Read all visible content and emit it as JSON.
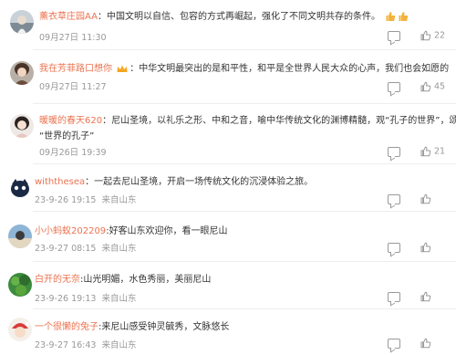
{
  "comments": [
    {
      "name": "薰衣草庄园AA",
      "text": "中国文明以自信、包容的方式再崛起，强化了不同文明共存的条件。",
      "emoji": "thumbs-up-icon",
      "time": "09月27日 11:30",
      "location": "",
      "likes": "22"
    },
    {
      "name": "我在芳菲路口想你",
      "text": "中华文明最突出的是和平性，和平是全世界人民大众的心声，我们也会如愿的",
      "time": "09月27日 11:27",
      "location": "",
      "likes": "45"
    },
    {
      "name": "暖暖的春天620",
      "text": "尼山圣境，以礼乐之形、中和之音，喻中华传统文化的渊博精髓，观“孔子的世界”，颂",
      "text2": "“世界的孔子”",
      "time": "09月26日 19:39",
      "location": "",
      "likes": "21"
    },
    {
      "name": "withthesea",
      "text": "一起去尼山圣境，开启一场传统文化的沉浸体验之旅。",
      "time": "23-9-26 19:15",
      "location": "来自山东",
      "likes": ""
    },
    {
      "name": "小小蚂蚁202209",
      "text": "好客山东欢迎你，看一眼尼山",
      "time": "23-9-27 08:15",
      "location": "来自山东",
      "likes": ""
    },
    {
      "name": "白开的无奈",
      "text": "山光明媚，水色秀丽，美丽尼山",
      "time": "23-9-26 19:13",
      "location": "来自山东",
      "likes": ""
    },
    {
      "name": "一个很懒的兔子",
      "text": "来尼山感受钟灵毓秀，文脉悠长",
      "time": "23-9-27 16:43",
      "location": "来自山东",
      "likes": ""
    }
  ],
  "colors": {
    "username": "#eb7350",
    "meta": "#999999",
    "text": "#333333"
  }
}
